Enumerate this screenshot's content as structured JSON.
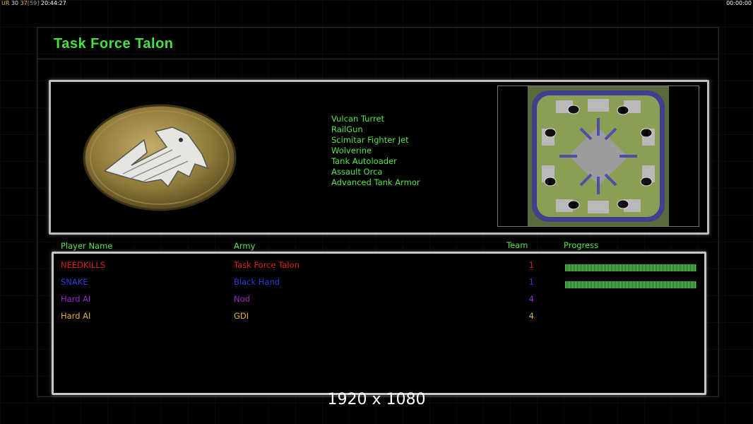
{
  "hud": {
    "label": "UR",
    "val1": "30",
    "val2": "37",
    "val3": "[59]",
    "clock": "20:44:27",
    "timer": "00:00:00"
  },
  "title": "Task Force Talon",
  "bonuses": [
    "Vulcan Turret",
    "RailGun",
    "Scimitar Fighter Jet",
    "Wolverine",
    "Tank Autoloader",
    "Assault Orca",
    "Advanced Tank Armor"
  ],
  "map": {
    "start_positions": [
      "1",
      "2",
      "3",
      "4"
    ]
  },
  "table": {
    "headers": {
      "player": "Player Name",
      "army": "Army",
      "team": "Team",
      "progress": "Progress"
    },
    "rows": [
      {
        "name": "NEEDKILLS",
        "army": "Task Force Talon",
        "team": "1",
        "color": "#e02020",
        "progress": 1.0
      },
      {
        "name": "SNAKE",
        "army": "Black Hand",
        "team": "1",
        "color": "#2a3ed8",
        "progress": 1.0
      },
      {
        "name": "Hard AI",
        "army": "Nod",
        "team": "4",
        "color": "#9a28d0",
        "progress": null
      },
      {
        "name": "Hard AI",
        "army": "GDI",
        "team": "4",
        "color": "#e8b030",
        "progress": null
      }
    ]
  },
  "resolution": "1920 x 1080"
}
